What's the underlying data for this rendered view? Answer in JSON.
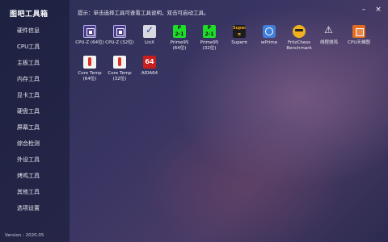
{
  "app": {
    "title": "图吧工具箱",
    "version": "Version : 2020.05"
  },
  "hint": "提示：单击选择工具可查看工具说明，双击可启动工具。",
  "window_controls": {
    "minimize": "–",
    "close": "×"
  },
  "sidebar": {
    "items": [
      {
        "label": "硬件信息"
      },
      {
        "label": "CPU工具"
      },
      {
        "label": "主板工具"
      },
      {
        "label": "内存工具"
      },
      {
        "label": "显卡工具"
      },
      {
        "label": "硬盘工具"
      },
      {
        "label": "屏幕工具"
      },
      {
        "label": "综合检测"
      },
      {
        "label": "外设工具"
      },
      {
        "label": "烤鸡工具"
      },
      {
        "label": "其他工具"
      },
      {
        "label": "选项设置"
      }
    ]
  },
  "tools": [
    {
      "label": "CPU-Z (64位)",
      "icon": "cpuz-icon",
      "glyph": ""
    },
    {
      "label": "CPU-Z (32位)",
      "icon": "cpuz-icon",
      "glyph": ""
    },
    {
      "label": "LinX",
      "icon": "linx-icon",
      "glyph": ""
    },
    {
      "label": "Prime95\n(64位)",
      "icon": "prime95-icon",
      "glyph": "P\n2-1"
    },
    {
      "label": "Prime95\n(32位)",
      "icon": "prime95-icon",
      "glyph": "P\n2-1"
    },
    {
      "label": "Superπ",
      "icon": "superpi-icon",
      "glyph": "Super\nπ"
    },
    {
      "label": "wPrime",
      "icon": "wprime-icon",
      "glyph": ""
    },
    {
      "label": "FritzChess\nBenchmark",
      "icon": "fritzchess-icon",
      "glyph": ""
    },
    {
      "label": "线程烧鸡",
      "icon": "warning-icon",
      "glyph": ""
    },
    {
      "label": "CPU天梯图",
      "icon": "cpu-ladder-icon",
      "glyph": ""
    },
    {
      "label": "Core Temp\n(64位)",
      "icon": "coretemp-icon",
      "glyph": ""
    },
    {
      "label": "Core Temp\n(32位)",
      "icon": "coretemp-icon",
      "glyph": ""
    },
    {
      "label": "AIDA64",
      "icon": "aida64-icon",
      "glyph": "64"
    }
  ],
  "colors": {
    "accent": "#3a3563",
    "sidebar": "#141832"
  }
}
